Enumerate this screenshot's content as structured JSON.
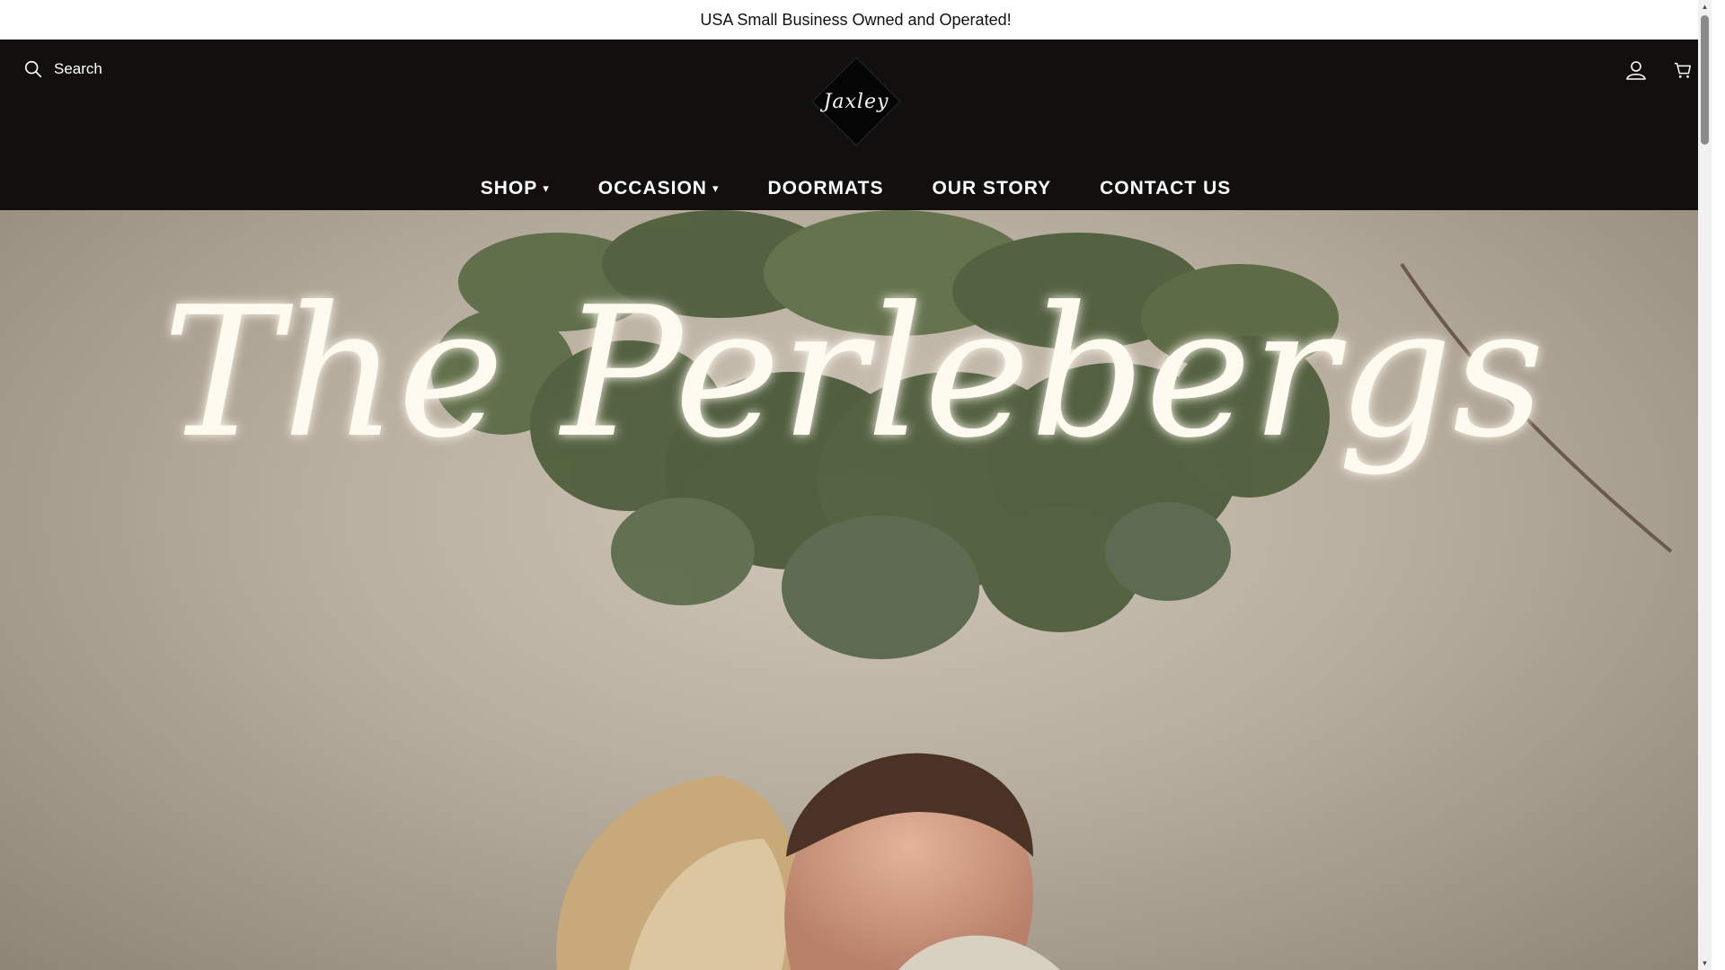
{
  "announcement": {
    "text": "USA Small Business Owned and Operated!"
  },
  "header": {
    "search_placeholder": "Search",
    "logo_text": "Jaxley",
    "account_icon": "user-icon",
    "cart_icon": "cart-icon"
  },
  "nav": {
    "items": [
      {
        "label": "SHOP",
        "has_dropdown": true
      },
      {
        "label": "OCCASION",
        "has_dropdown": true
      },
      {
        "label": "DOORMATS",
        "has_dropdown": false
      },
      {
        "label": "OUR STORY",
        "has_dropdown": false
      },
      {
        "label": "CONTACT US",
        "has_dropdown": false
      }
    ],
    "caret": "▾"
  },
  "hero": {
    "neon_text": "The Perlebergs"
  },
  "colors": {
    "header_bg": "#11100e",
    "announcement_bg": "#ffffff",
    "neon": "#fffaf0",
    "foliage": "#4d5c3a"
  }
}
